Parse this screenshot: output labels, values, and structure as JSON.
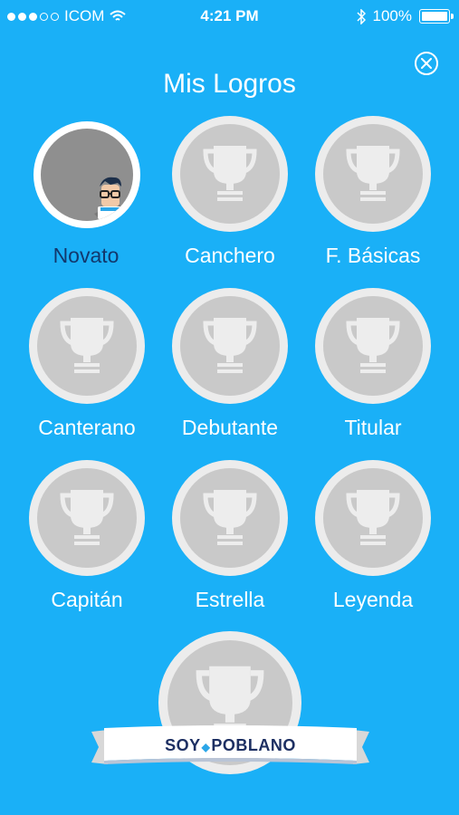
{
  "status_bar": {
    "carrier": "ICOM",
    "time": "4:21 PM",
    "battery": "100%",
    "signal_filled": 3,
    "signal_total": 5
  },
  "title": "Mis Logros",
  "achievements": [
    {
      "name": "Novato",
      "unlocked": true
    },
    {
      "name": "Canchero",
      "unlocked": false
    },
    {
      "name": "F. Básicas",
      "unlocked": false
    },
    {
      "name": "Canterano",
      "unlocked": false
    },
    {
      "name": "Debutante",
      "unlocked": false
    },
    {
      "name": "Titular",
      "unlocked": false
    },
    {
      "name": "Capitán",
      "unlocked": false
    },
    {
      "name": "Estrella",
      "unlocked": false
    },
    {
      "name": "Leyenda",
      "unlocked": false
    }
  ],
  "banner": {
    "left": "SOY",
    "right": "POBLANO"
  },
  "colors": {
    "background": "#1ab0f7",
    "active_label": "#12386d",
    "medal_outer": "#ececec",
    "medal_inner": "#c9c9c9"
  }
}
